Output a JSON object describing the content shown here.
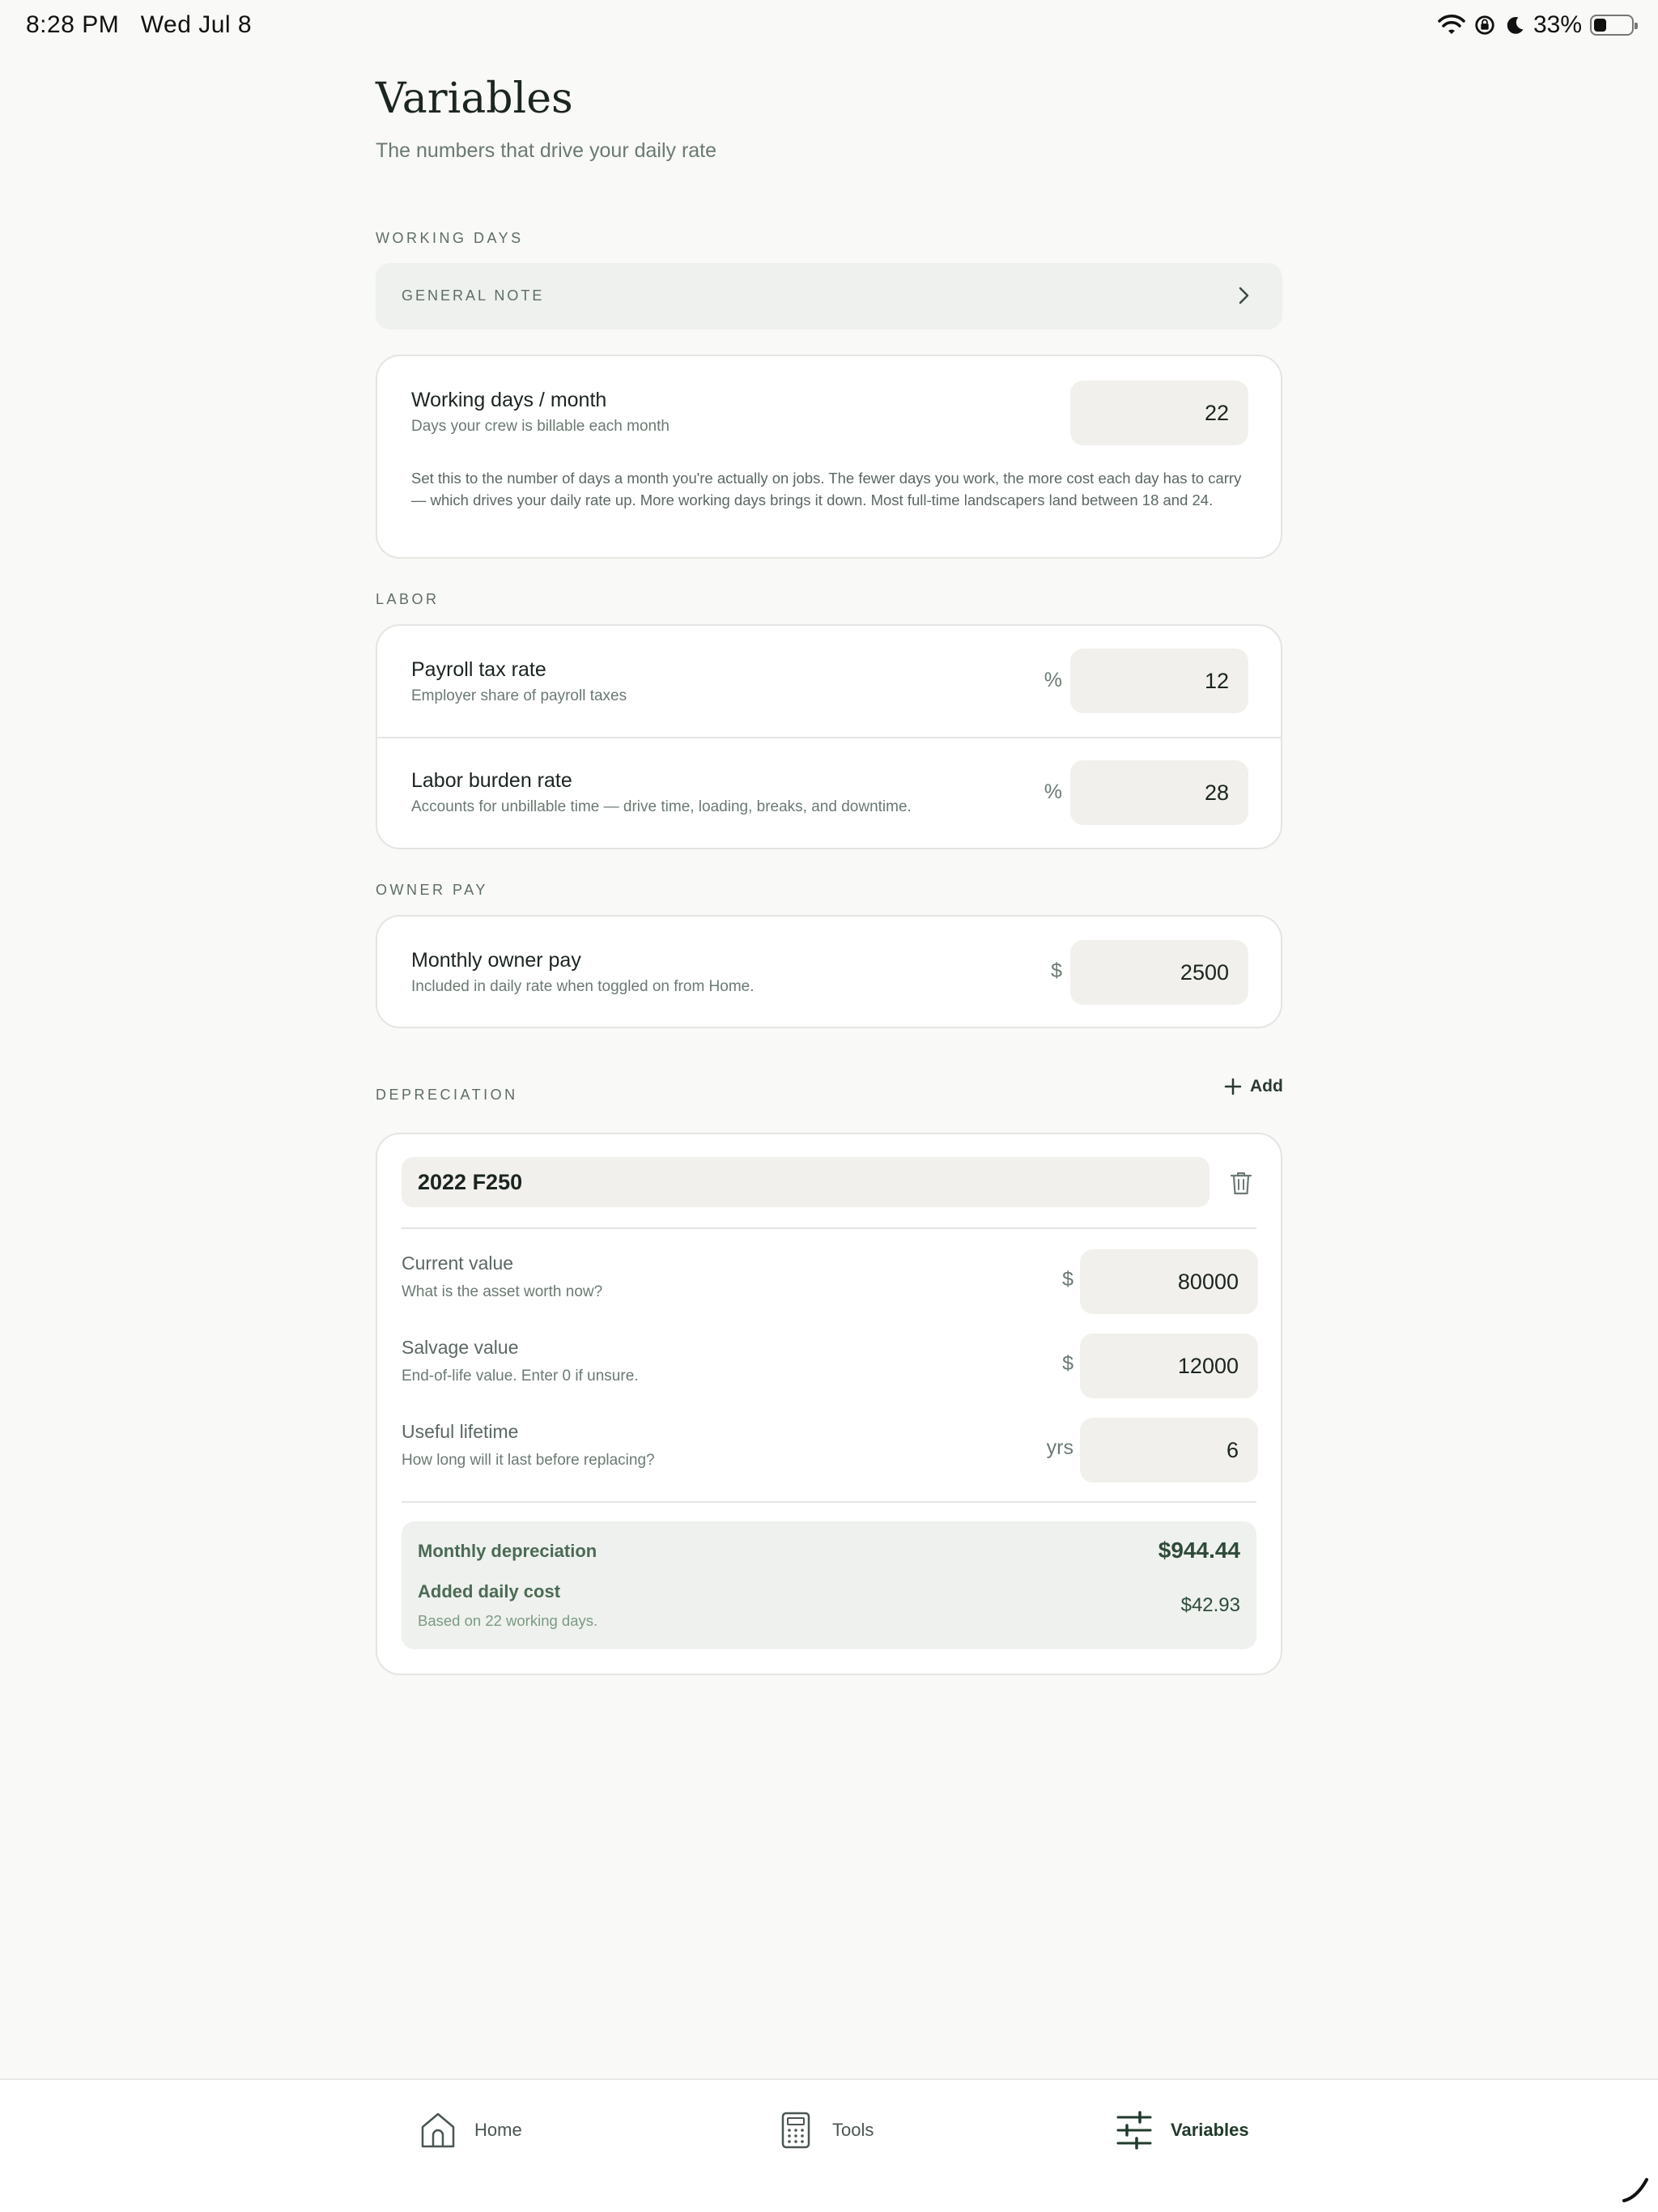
{
  "status_bar": {
    "time": "8:28 PM",
    "date": "Wed Jul 8",
    "battery_text": "33%",
    "battery_level": 0.33
  },
  "header": {
    "title": "Variables",
    "subtitle": "The numbers that drive your daily rate"
  },
  "sections": {
    "working_days": "WORKING DAYS",
    "labor": "LABOR",
    "owner_pay": "OWNER PAY",
    "depreciation": "DEPRECIATION"
  },
  "general_note": {
    "label": "GENERAL NOTE"
  },
  "working_days": {
    "title": "Working days / month",
    "description": "Days your crew is billable each month",
    "value": "22",
    "note": "Set this to the number of days a month you're actually on jobs. The fewer days you work, the more cost each day has to carry — which drives your daily rate up. More working days brings it down. Most full-time landscapers land between 18 and 24."
  },
  "labor": {
    "payroll": {
      "title": "Payroll tax rate",
      "description": "Employer share of payroll taxes",
      "unit": "%",
      "value": "12"
    },
    "burden": {
      "title": "Labor burden rate",
      "description": "Accounts for unbillable time — drive time, loading, breaks, and downtime.",
      "unit": "%",
      "value": "28"
    }
  },
  "owner_pay": {
    "title": "Monthly owner pay",
    "description": "Included in daily rate when toggled on from Home.",
    "unit": "$",
    "value": "2500"
  },
  "depreciation": {
    "add_label": "Add",
    "asset": {
      "name": "2022 F250",
      "current_value": {
        "title": "Current value",
        "description": "What is the asset worth now?",
        "unit": "$",
        "value": "80000"
      },
      "salvage_value": {
        "title": "Salvage value",
        "description": "End-of-life value. Enter 0 if unsure.",
        "unit": "$",
        "value": "12000"
      },
      "useful_lifetime": {
        "title": "Useful lifetime",
        "description": "How long will it last before replacing?",
        "unit": "yrs",
        "value": "6"
      },
      "summary": {
        "monthly_label": "Monthly depreciation",
        "monthly_value": "$944.44",
        "daily_label": "Added daily cost",
        "daily_desc": "Based on 22 working days.",
        "daily_value": "$42.93"
      }
    }
  },
  "tabbar": {
    "home": "Home",
    "tools": "Tools",
    "variables": "Variables"
  },
  "colors": {
    "background": "#f9f9f7",
    "accent": "#223a2c",
    "summary_bg": "#eef1ed"
  }
}
